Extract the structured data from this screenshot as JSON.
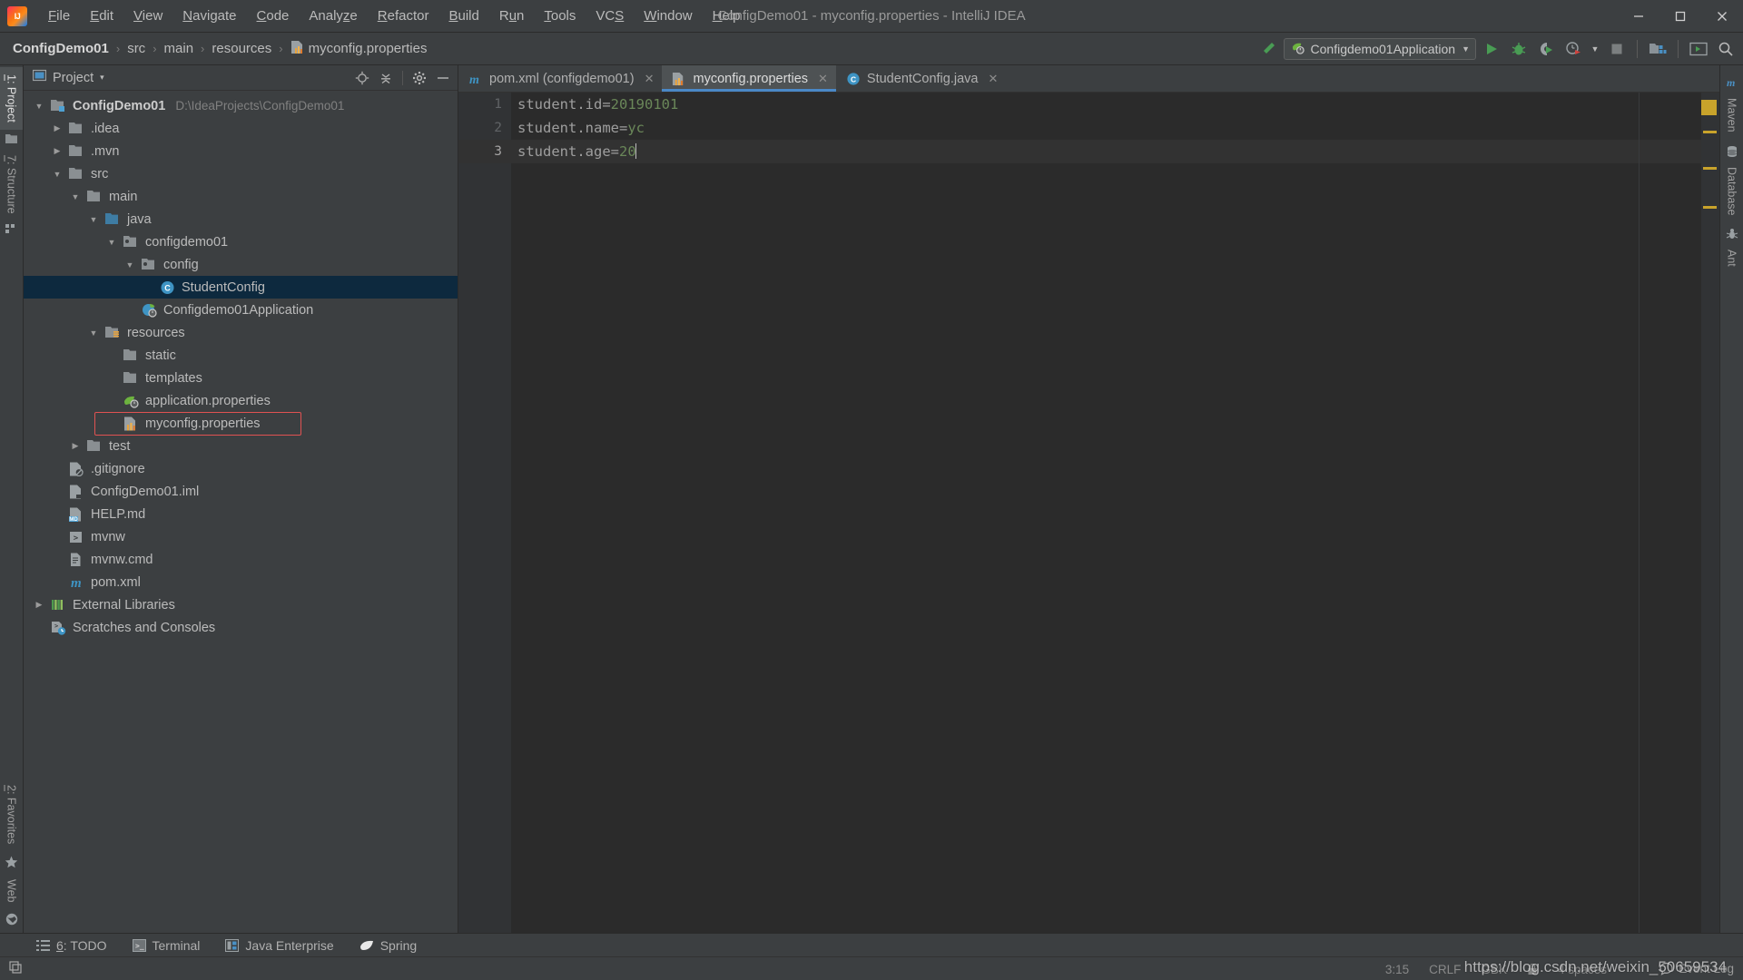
{
  "window": {
    "title": "ConfigDemo01 - myconfig.properties - IntelliJ IDEA",
    "logo_label": "IJ",
    "minimize": "—",
    "maximize": "❐",
    "close": "✕"
  },
  "menubar": {
    "items": [
      {
        "label": "File",
        "mnemonic": "F"
      },
      {
        "label": "Edit",
        "mnemonic": "E"
      },
      {
        "label": "View",
        "mnemonic": "V"
      },
      {
        "label": "Navigate",
        "mnemonic": "N"
      },
      {
        "label": "Code",
        "mnemonic": "C"
      },
      {
        "label": "Analyze",
        "mnemonic": "z"
      },
      {
        "label": "Refactor",
        "mnemonic": "R"
      },
      {
        "label": "Build",
        "mnemonic": "B"
      },
      {
        "label": "Run",
        "mnemonic": "u"
      },
      {
        "label": "Tools",
        "mnemonic": "T"
      },
      {
        "label": "VCS",
        "mnemonic": "S"
      },
      {
        "label": "Window",
        "mnemonic": "W"
      },
      {
        "label": "Help",
        "mnemonic": "H"
      }
    ]
  },
  "navbar": {
    "breadcrumb": [
      "ConfigDemo01",
      "src",
      "main",
      "resources",
      "myconfig.properties"
    ],
    "separator": "›",
    "run_config": "Configdemo01Application",
    "icons": [
      "hammer-icon",
      "run-icon",
      "debug-icon",
      "run-coverage-icon",
      "profiler-icon",
      "stop-icon",
      "project-structure-icon",
      "terminal-icon",
      "search-everywhere-icon"
    ]
  },
  "left_strip": {
    "top": [
      {
        "label": "1: Project",
        "mnemonic": "1",
        "active": true
      },
      {
        "label": "7: Structure",
        "mnemonic": "7",
        "active": false
      }
    ],
    "bottom": [
      {
        "label": "2: Favorites",
        "mnemonic": "2"
      },
      {
        "label": "Web",
        "mnemonic": ""
      }
    ]
  },
  "right_strip": {
    "items": [
      "Maven",
      "Database",
      "Ant"
    ]
  },
  "project_panel": {
    "title": "Project",
    "dropdown": "▾",
    "actions": [
      "locate-icon",
      "collapse-all-icon",
      "settings-gear-icon",
      "hide-icon"
    ],
    "tree": [
      {
        "depth": 0,
        "arrow": "▼",
        "icon": "project-folder-icon",
        "label": "ConfigDemo01",
        "bold": true,
        "path": "D:\\IdeaProjects\\ConfigDemo01"
      },
      {
        "depth": 1,
        "arrow": "▶",
        "icon": "folder-icon",
        "label": ".idea"
      },
      {
        "depth": 1,
        "arrow": "▶",
        "icon": "folder-icon",
        "label": ".mvn"
      },
      {
        "depth": 1,
        "arrow": "▼",
        "icon": "folder-icon",
        "label": "src"
      },
      {
        "depth": 2,
        "arrow": "▼",
        "icon": "folder-icon",
        "label": "main"
      },
      {
        "depth": 3,
        "arrow": "▼",
        "icon": "source-folder-icon",
        "label": "java"
      },
      {
        "depth": 4,
        "arrow": "▼",
        "icon": "package-icon",
        "label": "configdemo01"
      },
      {
        "depth": 5,
        "arrow": "▼",
        "icon": "package-icon",
        "label": "config"
      },
      {
        "depth": 6,
        "arrow": "",
        "icon": "java-class-icon",
        "label": "StudentConfig",
        "selected": true
      },
      {
        "depth": 5,
        "arrow": "",
        "icon": "spring-boot-class-icon",
        "label": "Configdemo01Application"
      },
      {
        "depth": 3,
        "arrow": "▼",
        "icon": "resources-folder-icon",
        "label": "resources"
      },
      {
        "depth": 4,
        "arrow": "",
        "icon": "folder-icon",
        "label": "static"
      },
      {
        "depth": 4,
        "arrow": "",
        "icon": "folder-icon",
        "label": "templates"
      },
      {
        "depth": 4,
        "arrow": "",
        "icon": "spring-properties-icon",
        "label": "application.properties"
      },
      {
        "depth": 4,
        "arrow": "",
        "icon": "properties-file-icon",
        "label": "myconfig.properties",
        "highlight_box": true
      },
      {
        "depth": 2,
        "arrow": "▶",
        "icon": "folder-icon",
        "label": "test"
      },
      {
        "depth": 1,
        "arrow": "",
        "icon": "gitignore-file-icon",
        "label": ".gitignore"
      },
      {
        "depth": 1,
        "arrow": "",
        "icon": "iml-file-icon",
        "label": "ConfigDemo01.iml"
      },
      {
        "depth": 1,
        "arrow": "",
        "icon": "markdown-file-icon",
        "label": "HELP.md"
      },
      {
        "depth": 1,
        "arrow": "",
        "icon": "shell-script-icon",
        "label": "mvnw"
      },
      {
        "depth": 1,
        "arrow": "",
        "icon": "cmd-file-icon",
        "label": "mvnw.cmd"
      },
      {
        "depth": 1,
        "arrow": "",
        "icon": "maven-pom-icon",
        "label": "pom.xml"
      },
      {
        "depth": 0,
        "arrow": "▶",
        "icon": "external-libraries-icon",
        "label": "External Libraries"
      },
      {
        "depth": 0,
        "arrow": "",
        "icon": "scratches-icon",
        "label": "Scratches and Consoles"
      }
    ]
  },
  "editor": {
    "tabs": [
      {
        "label": "pom.xml (configdemo01)",
        "icon": "maven-pom-icon",
        "active": false,
        "close": "✕"
      },
      {
        "label": "myconfig.properties",
        "icon": "properties-file-icon",
        "active": true,
        "close": "✕"
      },
      {
        "label": "StudentConfig.java",
        "icon": "java-class-icon",
        "active": false,
        "close": "✕"
      }
    ],
    "line_numbers": [
      "1",
      "2",
      "3"
    ],
    "current_line": 3,
    "lines": [
      {
        "key": "student.id",
        "eq": "=",
        "value": "20190101"
      },
      {
        "key": "student.name",
        "eq": "=",
        "value": "yc"
      },
      {
        "key": "student.age",
        "eq": "=",
        "value": "20"
      }
    ]
  },
  "bottom_tabs": [
    {
      "label": "6: TODO",
      "mnemonic": "6",
      "icon": "todo-icon"
    },
    {
      "label": "Terminal",
      "mnemonic": "",
      "icon": "terminal-icon"
    },
    {
      "label": "Java Enterprise",
      "mnemonic": "",
      "icon": "java-enterprise-icon"
    },
    {
      "label": "Spring",
      "mnemonic": "",
      "icon": "spring-icon"
    }
  ],
  "statusbar": {
    "left_icon": "toggle-toolwindows-icon",
    "caret_position": "3:15",
    "line_separator": "CRLF",
    "encoding": "GBK",
    "indent": "4 spaces",
    "event_log": "Event Log",
    "lock_icon": "lock-icon",
    "inspection_icon": "inspections-icon"
  },
  "watermark": "https://blog.csdn.net/weixin_50659534",
  "colors": {
    "chrome": "#3c3f41",
    "editor_bg": "#2b2b2b",
    "gutter_bg": "#313335",
    "selection": "#0d293e",
    "accent": "#4a88c7",
    "highlight_box": "#e05252",
    "string_green": "#6a8759",
    "run_green": "#499c54"
  }
}
